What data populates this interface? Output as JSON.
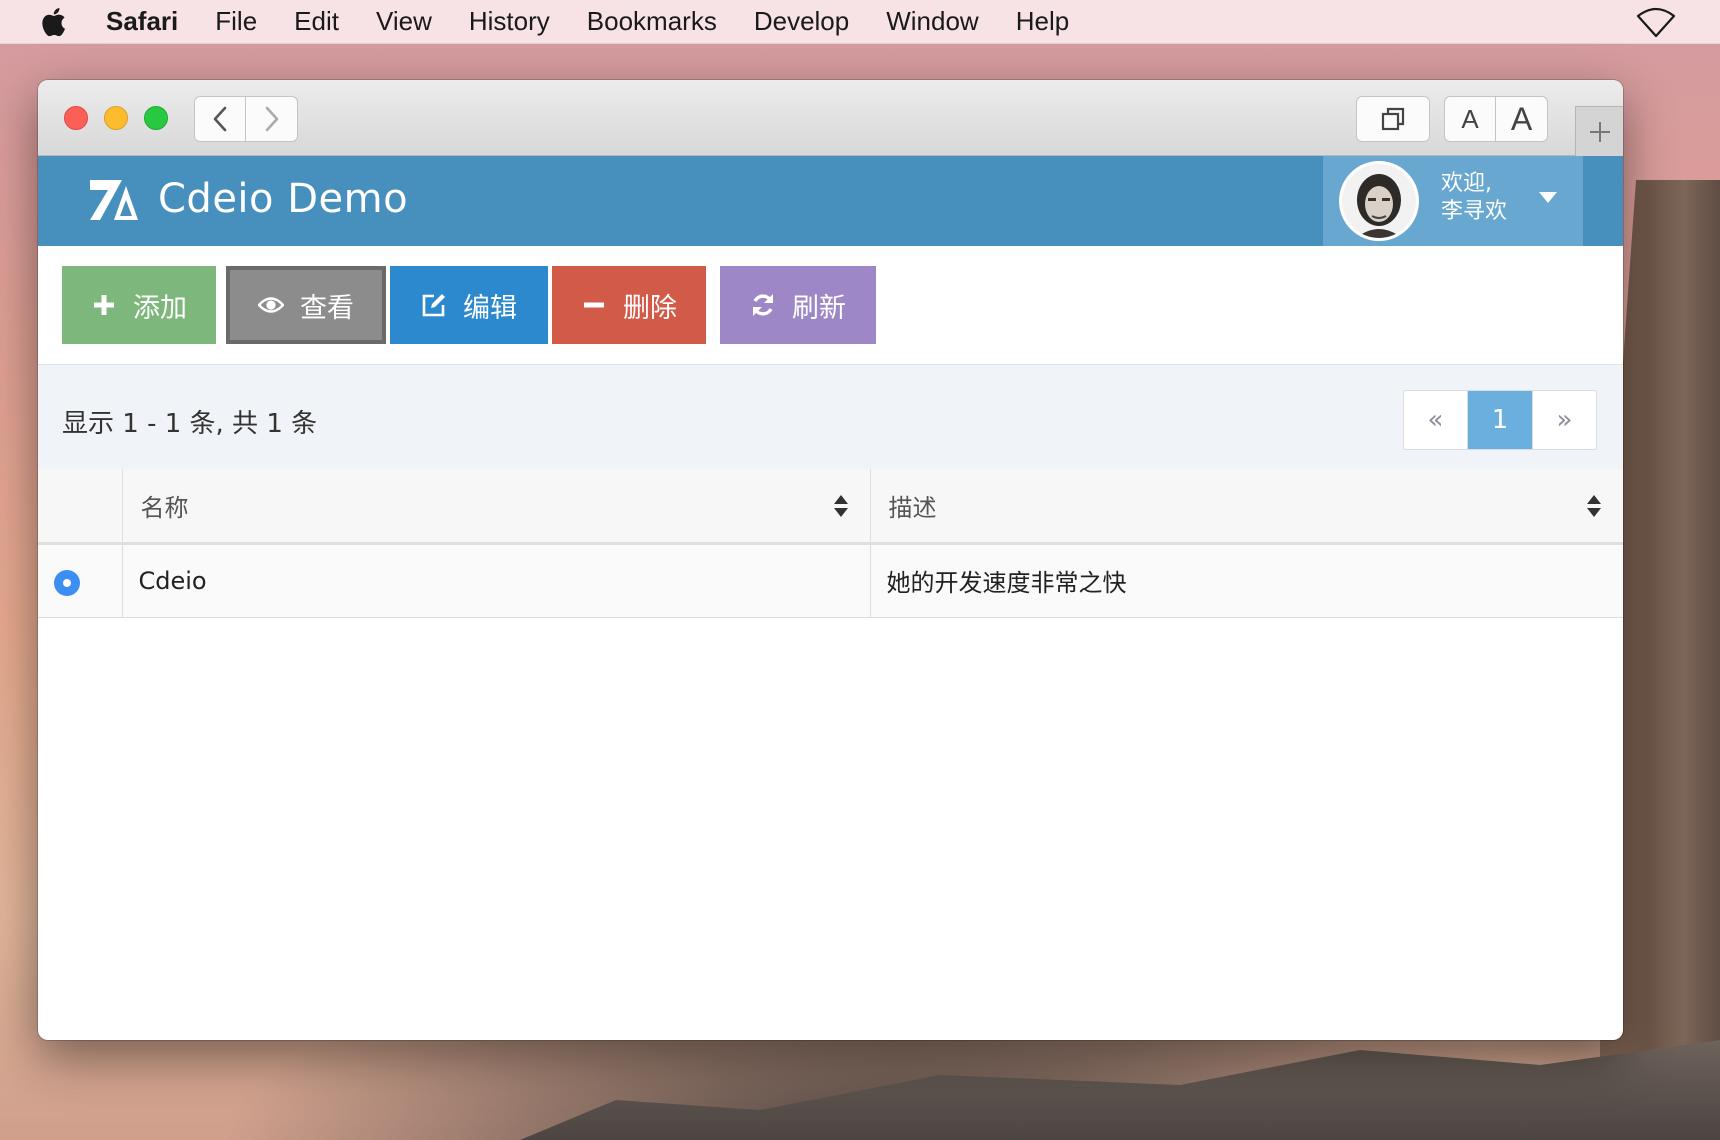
{
  "menubar": {
    "app": "Safari",
    "items": [
      "File",
      "Edit",
      "View",
      "History",
      "Bookmarks",
      "Develop",
      "Window",
      "Help"
    ],
    "icons": [
      "apple-icon",
      "wifi-icon"
    ]
  },
  "browser": {
    "font_small": "A",
    "font_large": "A",
    "icons": [
      "back-chevron-icon",
      "forward-chevron-icon",
      "tabs-icon",
      "plus-icon"
    ]
  },
  "header": {
    "brand": "Cdeio Demo",
    "welcome": "欢迎,",
    "username": "李寻欢",
    "color": "#4790bd",
    "user_box_color": "#67a7d0"
  },
  "actions": [
    {
      "label": "添加",
      "icon": "plus-icon",
      "color": "#7db77c"
    },
    {
      "label": "查看",
      "icon": "eye-icon",
      "color": "#8c8c8c"
    },
    {
      "label": "编辑",
      "icon": "edit-icon",
      "color": "#2d89ce"
    },
    {
      "label": "删除",
      "icon": "minus-icon",
      "color": "#d25a48"
    },
    {
      "label": "刷新",
      "icon": "refresh-icon",
      "color": "#9d87c6"
    }
  ],
  "summary": "显示 1 - 1 条, 共 1 条",
  "pager": {
    "first": "«",
    "current": "1",
    "last": "»"
  },
  "table": {
    "columns": [
      "名称",
      "描述"
    ],
    "rows": [
      {
        "name": "Cdeio",
        "description": "她的开发速度非常之快",
        "selected": true
      }
    ]
  }
}
